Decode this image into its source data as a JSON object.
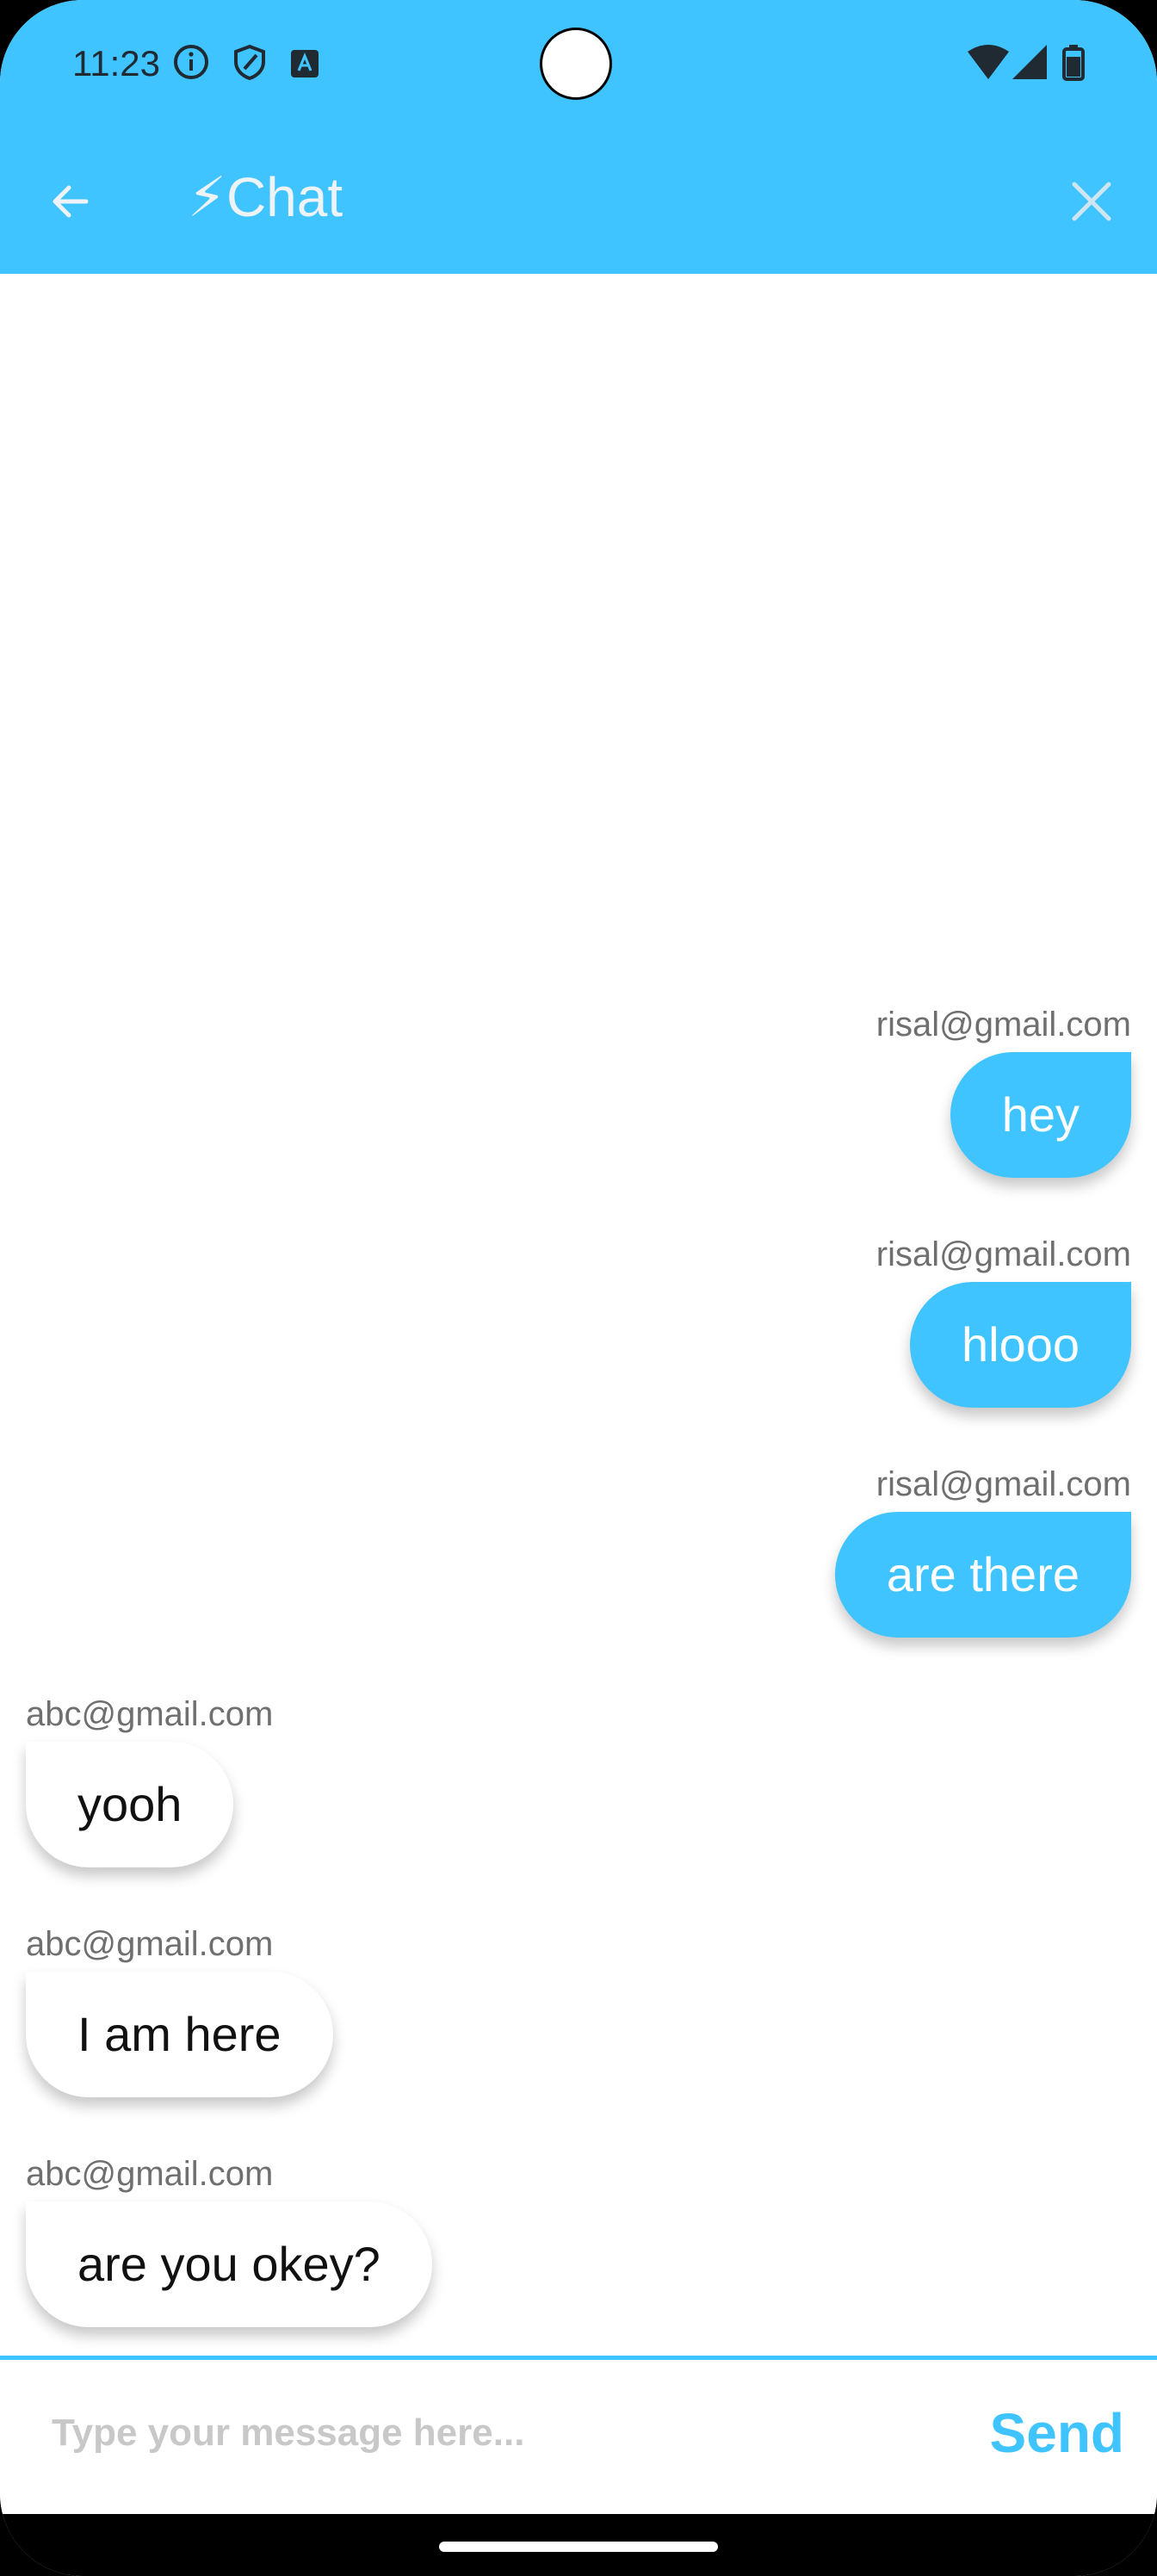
{
  "status_bar": {
    "time": "11:23",
    "left_icons": [
      "info-icon",
      "shield-icon",
      "keyboard-a-icon"
    ],
    "right_icons": [
      "wifi-icon",
      "signal-icon",
      "battery-icon"
    ]
  },
  "app_bar": {
    "title": "⚡Chat",
    "back_icon": "arrow-left-icon",
    "close_icon": "close-icon",
    "background_color": "#40c4ff"
  },
  "messages": [
    {
      "sender": "risal@gmail.com",
      "text": "hey",
      "mine": true
    },
    {
      "sender": "risal@gmail.com",
      "text": "hlooo",
      "mine": true
    },
    {
      "sender": "risal@gmail.com",
      "text": "are there",
      "mine": true
    },
    {
      "sender": "abc@gmail.com",
      "text": "yooh",
      "mine": false
    },
    {
      "sender": "abc@gmail.com",
      "text": "I am here",
      "mine": false
    },
    {
      "sender": "abc@gmail.com",
      "text": "are you okey?",
      "mine": false
    }
  ],
  "composer": {
    "placeholder": "Type your message here...",
    "value": "",
    "send_label": "Send"
  },
  "colors": {
    "accent": "#40c4ff",
    "my_bubble_text": "#ffffff",
    "their_bubble_bg": "#ffffff"
  }
}
